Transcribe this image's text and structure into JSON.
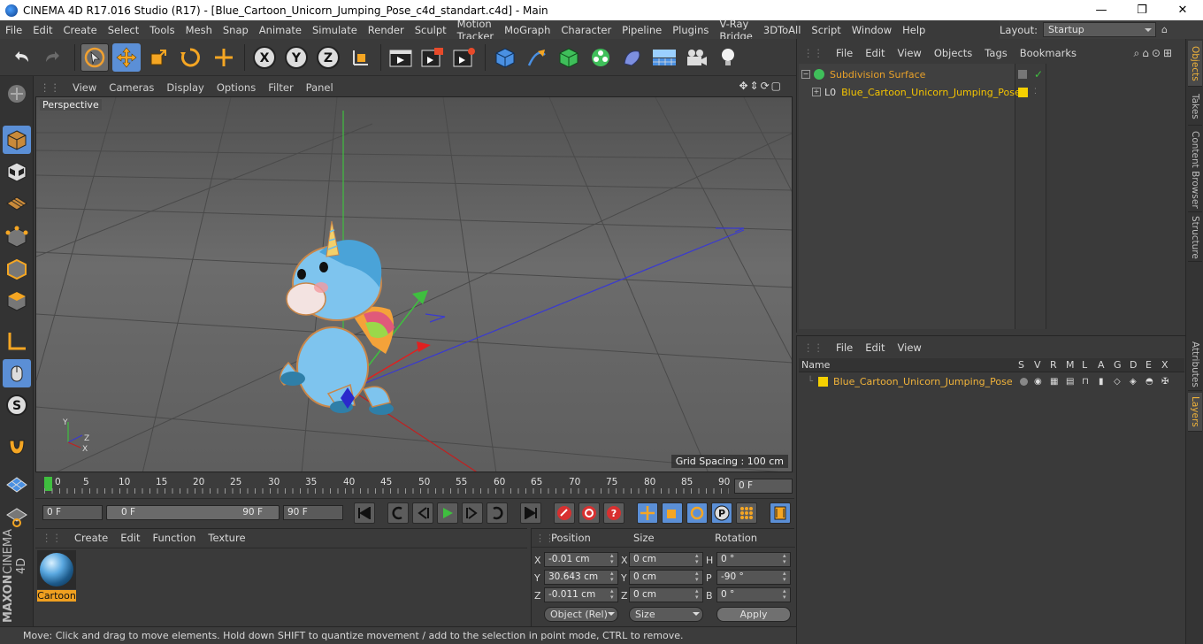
{
  "window": {
    "title": "CINEMA 4D R17.016 Studio (R17) - [Blue_Cartoon_Unicorn_Jumping_Pose_c4d_standart.c4d] - Main",
    "minimize": "—",
    "maximize": "❐",
    "close": "✕"
  },
  "menubar": {
    "items": [
      "File",
      "Edit",
      "Create",
      "Select",
      "Tools",
      "Mesh",
      "Snap",
      "Animate",
      "Simulate",
      "Render",
      "Sculpt",
      "Motion Tracker",
      "MoGraph",
      "Character",
      "Pipeline",
      "Plugins",
      "V-Ray Bridge",
      "3DToAll",
      "Script",
      "Window",
      "Help"
    ],
    "layout_label": "Layout:",
    "layout_value": "Startup"
  },
  "toolbar": {
    "icons": [
      "undo-icon",
      "redo-icon",
      "live-selection-icon",
      "move-icon",
      "scale-icon",
      "rotate-icon",
      "recent-tool-icon",
      "x-axis-icon",
      "y-axis-icon",
      "z-axis-icon",
      "coordinate-system-icon",
      "render-view-icon",
      "render-picture-viewer-icon",
      "render-settings-icon",
      "cube-icon",
      "pen-icon",
      "subdivision-icon",
      "cloner-icon",
      "deformer-icon",
      "floor-icon",
      "camera-icon",
      "light-icon"
    ],
    "axis_labels": [
      "X",
      "Y",
      "Z"
    ]
  },
  "viewport": {
    "menu": [
      "View",
      "Cameras",
      "Display",
      "Options",
      "Filter",
      "Panel"
    ],
    "camera_label": "Perspective",
    "grid_spacing": "Grid Spacing : 100 cm",
    "axis_labels": {
      "x": "X",
      "y": "Y",
      "z": "Z"
    }
  },
  "timeline": {
    "ticks": [
      "0",
      "5",
      "10",
      "15",
      "20",
      "25",
      "30",
      "35",
      "40",
      "45",
      "50",
      "55",
      "60",
      "65",
      "70",
      "75",
      "80",
      "85",
      "90"
    ],
    "current_frame": "0 F"
  },
  "playback": {
    "start": "0 F",
    "slider_start": "0 F",
    "slider_end": "90 F",
    "end": "90 F"
  },
  "material_panel": {
    "menu": [
      "Create",
      "Edit",
      "Function",
      "Texture"
    ],
    "material_name": "Cartoon"
  },
  "coordinates": {
    "headers": [
      "Position",
      "Size",
      "Rotation"
    ],
    "rows": [
      {
        "axis": "X",
        "pos": "-0.01 cm",
        "saxis": "X",
        "size": "0 cm",
        "raxis": "H",
        "rot": "0 °"
      },
      {
        "axis": "Y",
        "pos": "30.643 cm",
        "saxis": "Y",
        "size": "0 cm",
        "raxis": "P",
        "rot": "-90 °"
      },
      {
        "axis": "Z",
        "pos": "-0.011 cm",
        "saxis": "Z",
        "size": "0 cm",
        "raxis": "B",
        "rot": "0 °"
      }
    ],
    "mode": "Object (Rel)",
    "size_mode": "Size",
    "apply": "Apply"
  },
  "status": "Move: Click and drag to move elements. Hold down SHIFT to quantize movement / add to the selection in point mode, CTRL to remove.",
  "objects_panel": {
    "menu": [
      "File",
      "Edit",
      "View",
      "Objects",
      "Tags",
      "Bookmarks"
    ],
    "items": [
      {
        "name": "Subdivision Surface",
        "color": "#e8a12a"
      },
      {
        "name": "Blue_Cartoon_Unicorn_Jumping_Pose",
        "color": "#f5c400"
      }
    ]
  },
  "layers_panel": {
    "menu": [
      "File",
      "Edit",
      "View"
    ],
    "columns": [
      "Name",
      "S",
      "V",
      "R",
      "M",
      "L",
      "A",
      "G",
      "D",
      "E",
      "X"
    ],
    "layer_name": "Blue_Cartoon_Unicorn_Jumping_Pose",
    "layer_color": "#f5d000"
  },
  "side_tabs": [
    "Objects",
    "Takes",
    "Content Browser",
    "Structure",
    "Attributes",
    "Layers"
  ],
  "brand": [
    "MAXON",
    "CINEMA 4D"
  ],
  "colors": {
    "accent_blue": "#5b8fd6",
    "selection_orange": "#f0b33a"
  }
}
